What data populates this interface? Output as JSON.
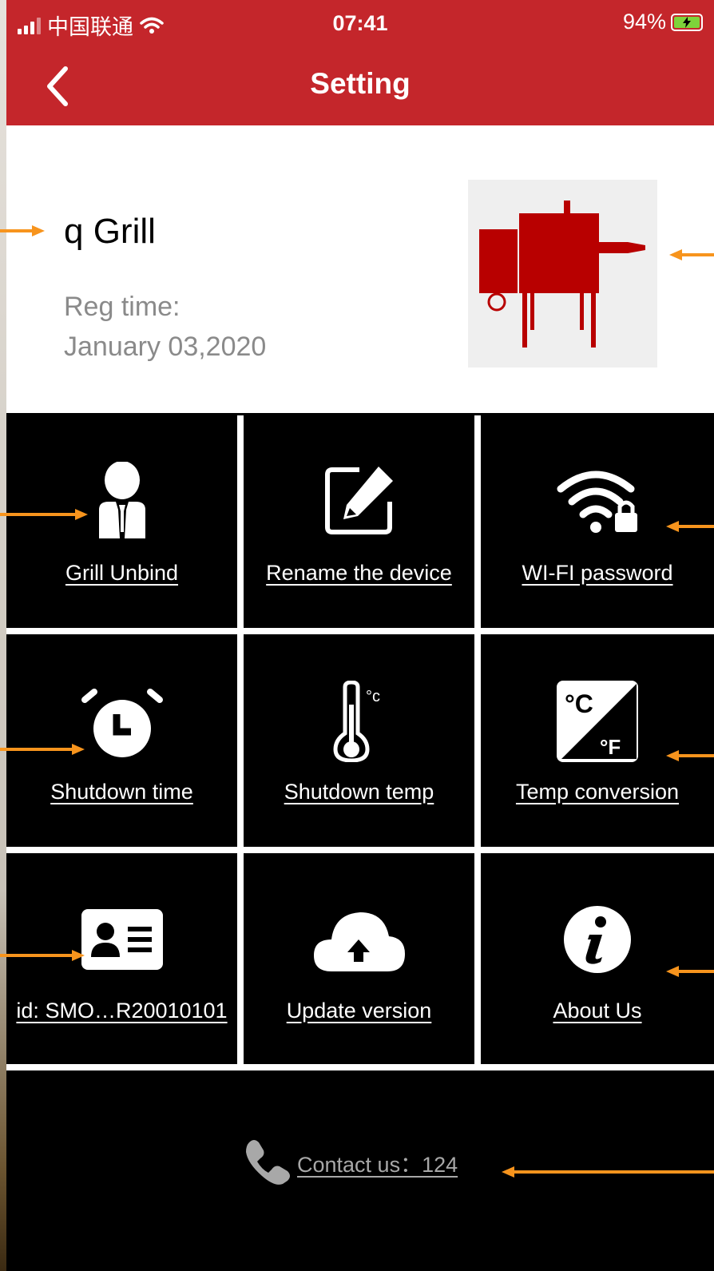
{
  "status_bar": {
    "carrier": "中国联通",
    "time": "07:41",
    "battery": "94%"
  },
  "header": {
    "title": "Setting"
  },
  "device": {
    "name": "q Grill",
    "reg_label": "Reg time:",
    "reg_date": "January 03,2020"
  },
  "tiles": [
    {
      "label": "Grill Unbind",
      "icon": "person-tie-icon"
    },
    {
      "label": "Rename the device",
      "icon": "edit-pencil-icon"
    },
    {
      "label": "WI-FI password",
      "icon": "wifi-lock-icon"
    },
    {
      "label": "Shutdown time",
      "icon": "alarm-clock-icon"
    },
    {
      "label": "Shutdown temp",
      "icon": "thermometer-icon",
      "icon_unit": "°c"
    },
    {
      "label": "Temp conversion",
      "icon": "celsius-fahrenheit-icon",
      "icon_c": "°C",
      "icon_f": "°F"
    },
    {
      "label": "id: SMO…R20010101",
      "icon": "id-card-icon"
    },
    {
      "label": "Update version",
      "icon": "cloud-upload-icon"
    },
    {
      "label": "About Us",
      "icon": "info-icon"
    }
  ],
  "contact": {
    "label": "Contact us：124",
    "icon": "phone-icon"
  },
  "colors": {
    "brand_red": "#c4262b",
    "grill_red": "#b80000",
    "annotation_arrow": "#f7941d"
  }
}
